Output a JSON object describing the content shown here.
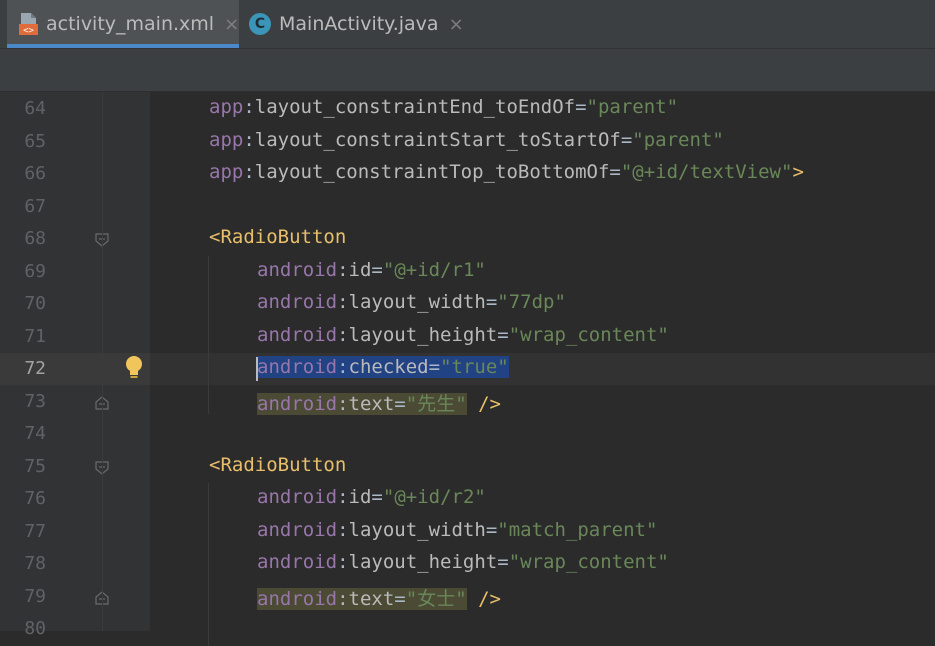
{
  "tabs": [
    {
      "label": "activity_main.xml",
      "icon": "xml-file-icon",
      "active": true
    },
    {
      "label": "MainActivity.java",
      "icon": "java-class-icon",
      "active": false
    }
  ],
  "close_glyph": "×",
  "lines": [
    {
      "n": "64",
      "code": [
        [
          "ns",
          "app"
        ],
        [
          "pun",
          ":"
        ],
        [
          "attr",
          "layout_constraintEnd_toEndOf"
        ],
        [
          "pun",
          "="
        ],
        [
          "val",
          "\"parent\""
        ]
      ]
    },
    {
      "n": "65",
      "code": [
        [
          "ns",
          "app"
        ],
        [
          "pun",
          ":"
        ],
        [
          "attr",
          "layout_constraintStart_toStartOf"
        ],
        [
          "pun",
          "="
        ],
        [
          "val",
          "\"parent\""
        ]
      ]
    },
    {
      "n": "66",
      "code": [
        [
          "ns",
          "app"
        ],
        [
          "pun",
          ":"
        ],
        [
          "attr",
          "layout_constraintTop_toBottomOf"
        ],
        [
          "pun",
          "="
        ],
        [
          "val",
          "\"@+id/textView\""
        ],
        [
          "tag",
          ">"
        ]
      ]
    },
    {
      "n": "67",
      "code": []
    },
    {
      "n": "68",
      "code": [
        [
          "tag",
          "<RadioButton"
        ]
      ]
    },
    {
      "n": "69",
      "code": [
        [
          "ns",
          "android"
        ],
        [
          "pun",
          ":"
        ],
        [
          "attr",
          "id"
        ],
        [
          "pun",
          "="
        ],
        [
          "val",
          "\"@+id/r1\""
        ]
      ]
    },
    {
      "n": "70",
      "code": [
        [
          "ns",
          "android"
        ],
        [
          "pun",
          ":"
        ],
        [
          "attr",
          "layout_width"
        ],
        [
          "pun",
          "="
        ],
        [
          "val",
          "\"77dp\""
        ]
      ]
    },
    {
      "n": "71",
      "code": [
        [
          "ns",
          "android"
        ],
        [
          "pun",
          ":"
        ],
        [
          "attr",
          "layout_height"
        ],
        [
          "pun",
          "="
        ],
        [
          "val",
          "\"wrap_content\""
        ]
      ]
    },
    {
      "n": "72",
      "code": [
        [
          "ns",
          "android"
        ],
        [
          "pun",
          ":"
        ],
        [
          "attr",
          "checked"
        ],
        [
          "pun",
          "="
        ],
        [
          "val",
          "\"true\""
        ]
      ]
    },
    {
      "n": "73",
      "code": [
        [
          "ns",
          "android"
        ],
        [
          "pun",
          ":"
        ],
        [
          "attr",
          "text"
        ],
        [
          "pun",
          "="
        ],
        [
          "val",
          "\"先生\""
        ],
        [
          "pun",
          " "
        ],
        [
          "tag",
          "/>"
        ]
      ]
    },
    {
      "n": "74",
      "code": []
    },
    {
      "n": "75",
      "code": [
        [
          "tag",
          "<RadioButton"
        ]
      ]
    },
    {
      "n": "76",
      "code": [
        [
          "ns",
          "android"
        ],
        [
          "pun",
          ":"
        ],
        [
          "attr",
          "id"
        ],
        [
          "pun",
          "="
        ],
        [
          "val",
          "\"@+id/r2\""
        ]
      ]
    },
    {
      "n": "77",
      "code": [
        [
          "ns",
          "android"
        ],
        [
          "pun",
          ":"
        ],
        [
          "attr",
          "layout_width"
        ],
        [
          "pun",
          "="
        ],
        [
          "val",
          "\"match_parent\""
        ]
      ]
    },
    {
      "n": "78",
      "code": [
        [
          "ns",
          "android"
        ],
        [
          "pun",
          ":"
        ],
        [
          "attr",
          "layout_height"
        ],
        [
          "pun",
          "="
        ],
        [
          "val",
          "\"wrap_content\""
        ]
      ]
    },
    {
      "n": "79",
      "code": [
        [
          "ns",
          "android"
        ],
        [
          "pun",
          ":"
        ],
        [
          "attr",
          "text"
        ],
        [
          "pun",
          "="
        ],
        [
          "val",
          "\"女士\""
        ],
        [
          "pun",
          " "
        ],
        [
          "tag",
          "/>"
        ]
      ]
    },
    {
      "n": "80",
      "code": []
    }
  ],
  "current_line": "72",
  "colors": {
    "namespace": "#9876aa",
    "attribute": "#bababa",
    "value": "#6a8759",
    "tag": "#e8bf6a",
    "selection": "#214283",
    "accent": "#4a88c7"
  }
}
